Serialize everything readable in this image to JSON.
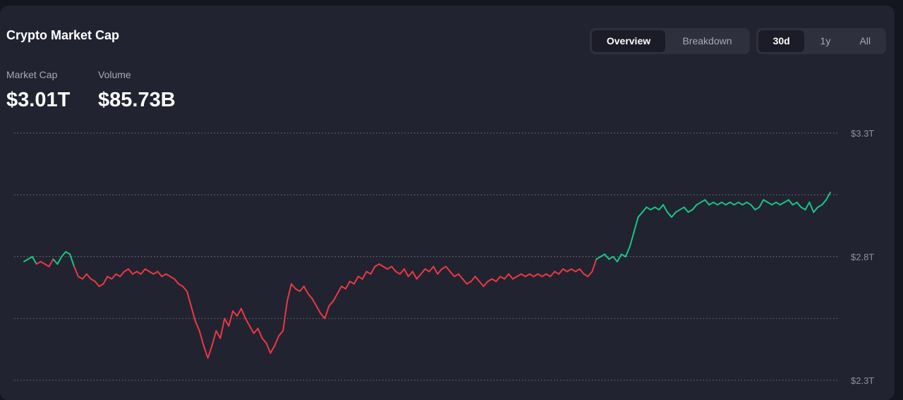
{
  "header": {
    "title": "Crypto Market Cap"
  },
  "view_toggle": {
    "options": [
      "Overview",
      "Breakdown"
    ],
    "selected": "Overview"
  },
  "range_toggle": {
    "options": [
      "30d",
      "1y",
      "All"
    ],
    "selected": "30d"
  },
  "stats": {
    "market_cap_label": "Market Cap",
    "market_cap_value": "$3.01T",
    "volume_label": "Volume",
    "volume_value": "$85.73B"
  },
  "colors": {
    "up": "#16c784",
    "down": "#ea3943",
    "grid": "#8d90a0"
  },
  "chart_data": {
    "type": "line",
    "title": "",
    "xlabel": "",
    "ylabel": "",
    "ylim": [
      2.3,
      3.3
    ],
    "ytick_labels": [
      "$3.3T",
      "$2.8T",
      "$2.3T"
    ],
    "ytick_values": [
      3.3,
      2.8,
      2.3
    ],
    "gridlines": [
      3.3,
      3.05,
      2.8,
      2.55,
      2.3
    ],
    "baseline": 2.78,
    "series": [
      {
        "values": [
          2.78,
          2.79,
          2.8,
          2.77,
          2.78,
          2.77,
          2.76,
          2.79,
          2.77,
          2.8,
          2.82,
          2.81,
          2.76,
          2.72,
          2.71,
          2.73,
          2.71,
          2.7,
          2.68,
          2.69,
          2.72,
          2.71,
          2.73,
          2.72,
          2.74,
          2.75,
          2.73,
          2.74,
          2.73,
          2.75,
          2.74,
          2.73,
          2.74,
          2.72,
          2.73,
          2.72,
          2.71,
          2.69,
          2.68,
          2.66,
          2.6,
          2.54,
          2.5,
          2.44,
          2.39,
          2.44,
          2.5,
          2.47,
          2.55,
          2.52,
          2.58,
          2.56,
          2.59,
          2.55,
          2.52,
          2.49,
          2.51,
          2.47,
          2.45,
          2.41,
          2.44,
          2.48,
          2.5,
          2.62,
          2.69,
          2.67,
          2.66,
          2.68,
          2.65,
          2.63,
          2.6,
          2.57,
          2.55,
          2.6,
          2.62,
          2.65,
          2.68,
          2.67,
          2.7,
          2.69,
          2.72,
          2.71,
          2.74,
          2.73,
          2.76,
          2.77,
          2.76,
          2.75,
          2.76,
          2.74,
          2.73,
          2.75,
          2.72,
          2.74,
          2.71,
          2.73,
          2.75,
          2.74,
          2.76,
          2.73,
          2.75,
          2.76,
          2.74,
          2.72,
          2.73,
          2.71,
          2.69,
          2.7,
          2.72,
          2.7,
          2.68,
          2.7,
          2.71,
          2.7,
          2.72,
          2.71,
          2.73,
          2.71,
          2.72,
          2.73,
          2.72,
          2.73,
          2.72,
          2.73,
          2.72,
          2.73,
          2.72,
          2.74,
          2.73,
          2.75,
          2.74,
          2.75,
          2.74,
          2.75,
          2.73,
          2.72,
          2.74,
          2.79,
          2.8,
          2.81,
          2.79,
          2.8,
          2.78,
          2.81,
          2.8,
          2.84,
          2.9,
          2.96,
          2.98,
          3.0,
          2.99,
          3.0,
          2.99,
          3.01,
          2.98,
          2.96,
          2.98,
          2.99,
          3.0,
          2.98,
          2.99,
          3.01,
          3.02,
          3.03,
          3.01,
          3.02,
          3.01,
          3.02,
          3.01,
          3.02,
          3.01,
          3.02,
          3.01,
          3.02,
          3.01,
          2.99,
          3.0,
          3.03,
          3.02,
          3.01,
          3.02,
          3.01,
          3.02,
          3.03,
          3.01,
          3.02,
          3.0,
          2.99,
          3.02,
          2.98,
          3.0,
          3.01,
          3.03,
          3.06
        ]
      }
    ]
  }
}
